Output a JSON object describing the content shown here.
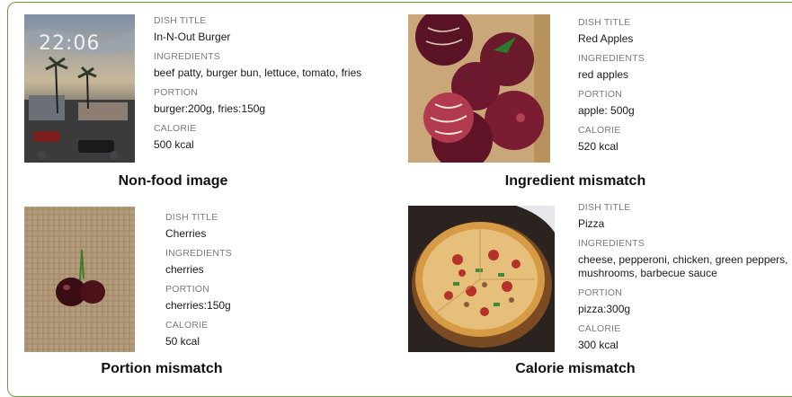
{
  "cards": [
    {
      "image_alt": "phone lock screen showing 22:06 over a street scene",
      "clock": "22:06",
      "fields": [
        {
          "label": "DISH TITLE",
          "value": "In-N-Out Burger"
        },
        {
          "label": "INGREDIENTS",
          "value": "beef patty, burger bun, lettuce, tomato, fries"
        },
        {
          "label": "PORTION",
          "value": "burger:200g, fries:150g"
        },
        {
          "label": "CALORIE",
          "value": "500 kcal"
        }
      ],
      "caption": "Non-food image"
    },
    {
      "image_alt": "box of red apples",
      "fields": [
        {
          "label": "DISH TITLE",
          "value": "Red Apples"
        },
        {
          "label": "INGREDIENTS",
          "value": "red apples"
        },
        {
          "label": "PORTION",
          "value": "apple: 500g"
        },
        {
          "label": "CALORIE",
          "value": "520 kcal"
        }
      ],
      "caption": "Ingredient mismatch"
    },
    {
      "image_alt": "two cherries on a woven mat",
      "fields": [
        {
          "label": "DISH TITLE",
          "value": "Cherries"
        },
        {
          "label": "INGREDIENTS",
          "value": "cherries"
        },
        {
          "label": "PORTION",
          "value": "cherries:150g"
        },
        {
          "label": "CALORIE",
          "value": "50 kcal"
        }
      ],
      "caption": "Portion mismatch"
    },
    {
      "image_alt": "pizza on a wooden board",
      "fields": [
        {
          "label": "DISH TITLE",
          "value": "Pizza"
        },
        {
          "label": "INGREDIENTS",
          "value": "cheese, pepperoni, chicken, green peppers, mushrooms, barbecue sauce"
        },
        {
          "label": "PORTION",
          "value": "pizza:300g"
        },
        {
          "label": "CALORIE",
          "value": "300 kcal"
        }
      ],
      "caption": "Calorie mismatch"
    }
  ],
  "colors": {
    "border": "#6a9a3a",
    "label": "#7a7a7a",
    "value": "#1a1a1a"
  }
}
